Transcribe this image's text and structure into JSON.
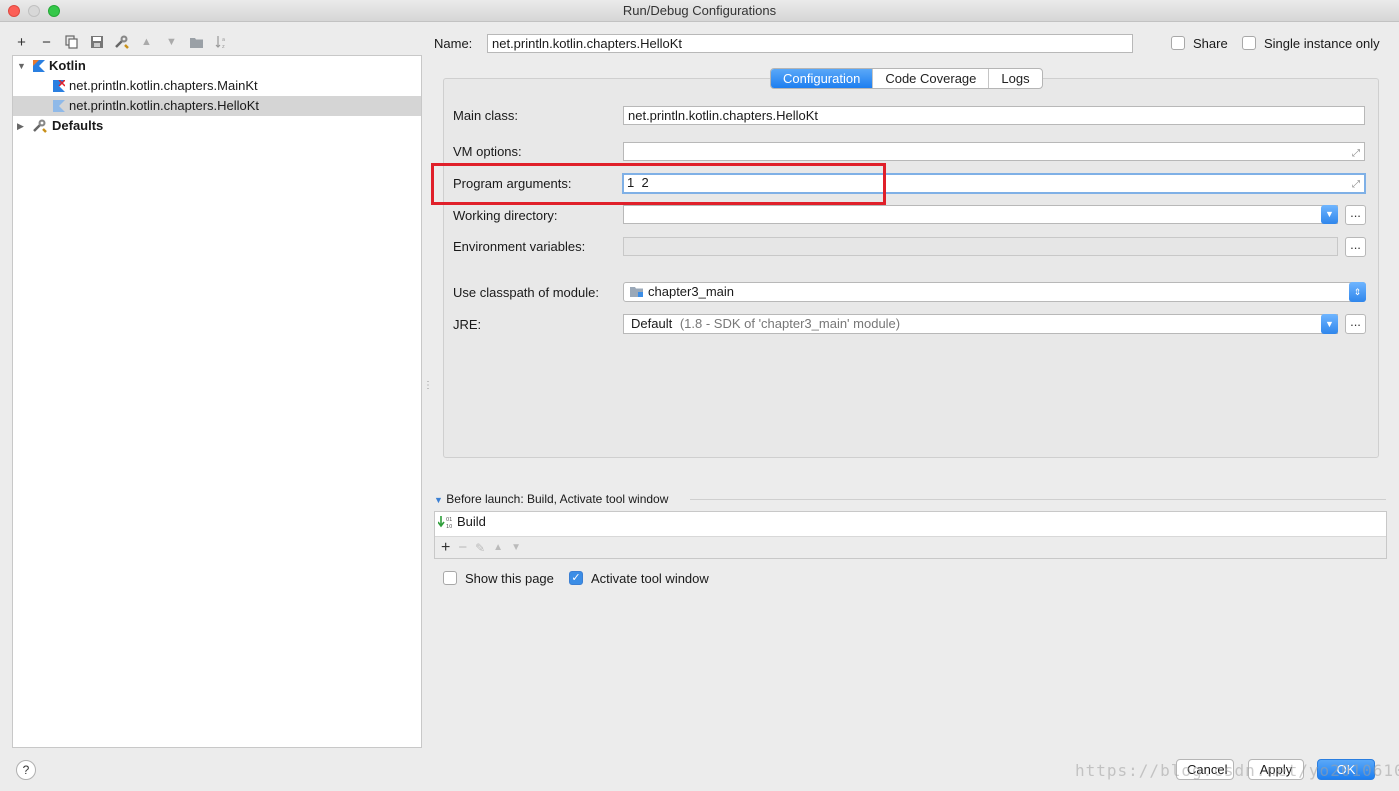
{
  "window": {
    "title": "Run/Debug Configurations"
  },
  "toolbar": {
    "buttons": [
      {
        "name": "add-icon",
        "glyph": "+"
      },
      {
        "name": "remove-icon",
        "glyph": "−"
      },
      {
        "name": "copy-icon",
        "glyph": "⧉"
      },
      {
        "name": "save-icon",
        "glyph": "▣"
      },
      {
        "name": "wrench-icon",
        "glyph": "⚒"
      },
      {
        "name": "move-up-icon",
        "glyph": "▲"
      },
      {
        "name": "move-down-icon",
        "glyph": "▼"
      },
      {
        "name": "folder-icon",
        "glyph": "▬"
      },
      {
        "name": "sort-icon",
        "glyph": "↓"
      }
    ]
  },
  "tree": {
    "kotlin": "Kotlin",
    "items": [
      {
        "label": "net.println.kotlin.chapters.MainKt"
      },
      {
        "label": "net.println.kotlin.chapters.HelloKt"
      }
    ],
    "defaults": "Defaults"
  },
  "header": {
    "name_label": "Name:",
    "name_value": "net.println.kotlin.chapters.HelloKt",
    "share_label": "Share",
    "single_instance_label": "Single instance only"
  },
  "tabs": [
    {
      "label": "Configuration"
    },
    {
      "label": "Code Coverage"
    },
    {
      "label": "Logs"
    }
  ],
  "form": {
    "main_class_label": "Main class:",
    "main_class_value": "net.println.kotlin.chapters.HelloKt",
    "vm_options_label": "VM options:",
    "vm_options_value": "",
    "program_args_label": "Program arguments:",
    "program_args_value": "1  2",
    "working_dir_label": "Working directory:",
    "working_dir_value": "",
    "env_vars_label": "Environment variables:",
    "env_vars_value": "",
    "classpath_label": "Use classpath of module:",
    "classpath_value": "chapter3_main",
    "jre_label": "JRE:",
    "jre_value": "Default",
    "jre_detail": "(1.8 - SDK of 'chapter3_main' module)",
    "dots": "..."
  },
  "before_launch": {
    "title": "Before launch: Build, Activate tool window",
    "items": [
      {
        "label": "Build"
      }
    ]
  },
  "options": {
    "show_page_label": "Show this page",
    "activate_tool_window_label": "Activate tool window"
  },
  "buttons": {
    "help": "?",
    "cancel": "Cancel",
    "apply": "Apply",
    "ok": "OK"
  },
  "watermark": "https://blog.csdn.net/yo2010610",
  "colors": {
    "accent": "#1d7ef0",
    "highlight": "#e0202a"
  }
}
